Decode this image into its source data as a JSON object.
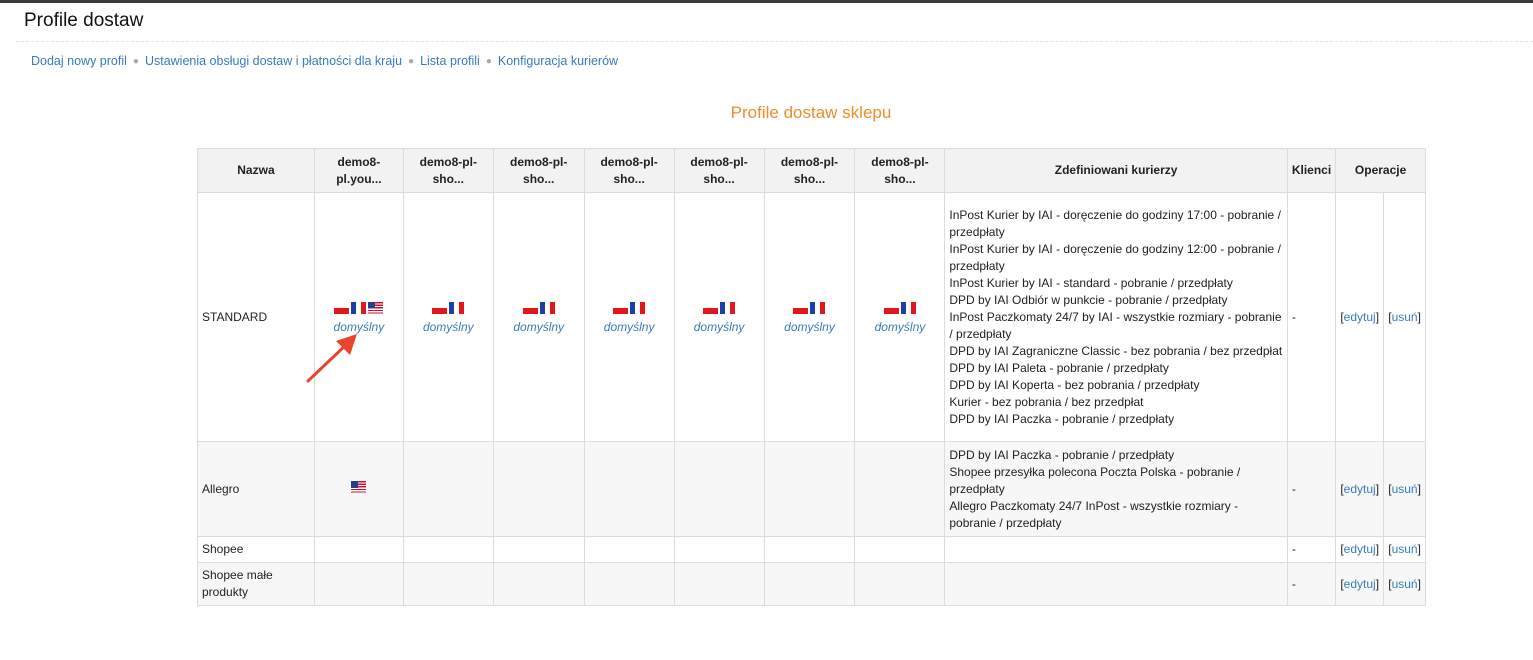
{
  "page": {
    "title": "Profile dostaw"
  },
  "nav": {
    "links": [
      "Dodaj nowy profil",
      "Ustawienia obsługi dostaw i płatności dla kraju",
      "Lista profili",
      "Konfiguracja kurierów"
    ]
  },
  "section_title": "Profile dostaw sklepu",
  "table": {
    "headers": {
      "name": "Nazwa",
      "shops": [
        "demo8-pl.you...",
        "demo8-pl-sho...",
        "demo8-pl-sho...",
        "demo8-pl-sho...",
        "demo8-pl-sho...",
        "demo8-pl-sho...",
        "demo8-pl-sho..."
      ],
      "couriers": "Zdefiniowani kurierzy",
      "clients": "Klienci",
      "operations": "Operacje"
    },
    "default_label": "domyślny",
    "flag_icons": {
      "pl": "flag-poland-icon",
      "fr": "flag-france-icon",
      "us": "flag-usa-icon"
    },
    "rows": [
      {
        "name": "STANDARD",
        "shop_flags": [
          [
            "pl",
            "fr",
            "us"
          ],
          [
            "pl",
            "fr"
          ],
          [
            "pl",
            "fr"
          ],
          [
            "pl",
            "fr"
          ],
          [
            "pl",
            "fr"
          ],
          [
            "pl",
            "fr"
          ],
          [
            "pl",
            "fr"
          ]
        ],
        "shop_default": [
          true,
          true,
          true,
          true,
          true,
          true,
          true
        ],
        "couriers": [
          "InPost Kurier by IAI - doręczenie do godziny 17:00 - pobranie / przedpłaty",
          "InPost Kurier by IAI - doręczenie do godziny 12:00 - pobranie / przedpłaty",
          "InPost Kurier by IAI - standard - pobranie / przedpłaty",
          "DPD by IAI Odbiór w punkcie - pobranie / przedpłaty",
          "InPost Paczkomaty 24/7 by IAI - wszystkie rozmiary - pobranie / przedpłaty",
          "DPD by IAI Zagraniczne Classic - bez pobrania / bez przedpłat",
          "DPD by IAI Paleta - pobranie / przedpłaty",
          "DPD by IAI Koperta - bez pobrania / przedpłaty",
          "Kurier - bez pobrania / bez przedpłat",
          "DPD by IAI Paczka - pobranie / przedpłaty"
        ],
        "clients": "-",
        "edit_label": "edytuj",
        "delete_label": "usuń"
      },
      {
        "name": "Allegro",
        "shop_flags": [
          [
            "us"
          ],
          [],
          [],
          [],
          [],
          [],
          []
        ],
        "shop_default": [
          false,
          false,
          false,
          false,
          false,
          false,
          false
        ],
        "couriers": [
          "DPD by IAI Paczka - pobranie / przedpłaty",
          "Shopee przesyłka polecona Poczta Polska - pobranie / przedpłaty",
          "Allegro Paczkomaty 24/7 InPost - wszystkie rozmiary - pobranie / przedpłaty"
        ],
        "clients": "-",
        "edit_label": "edytuj",
        "delete_label": "usuń"
      },
      {
        "name": "Shopee",
        "shop_flags": [
          [],
          [],
          [],
          [],
          [],
          [],
          []
        ],
        "shop_default": [
          false,
          false,
          false,
          false,
          false,
          false,
          false
        ],
        "couriers": [],
        "clients": "-",
        "edit_label": "edytuj",
        "delete_label": "usuń"
      },
      {
        "name": "Shopee małe produkty",
        "shop_flags": [
          [],
          [],
          [],
          [],
          [],
          [],
          []
        ],
        "shop_default": [
          false,
          false,
          false,
          false,
          false,
          false,
          false
        ],
        "couriers": [],
        "clients": "-",
        "edit_label": "edytuj",
        "delete_label": "usuń"
      }
    ]
  },
  "colors": {
    "link": "#3a7bbf",
    "section_title": "#f08c2a",
    "arrow": "#e8452c",
    "header_bg": "#f2f2f2"
  }
}
